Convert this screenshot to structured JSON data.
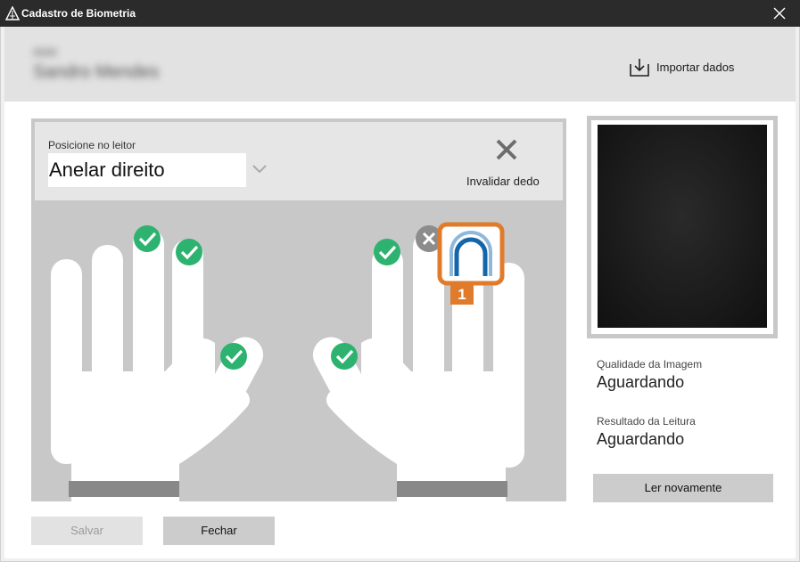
{
  "window": {
    "title": "Cadastro de Biometria",
    "icon": "app-logo-icon",
    "close_icon": "close-icon"
  },
  "header": {
    "person_code": "0000",
    "person_name": "Sandro Mendes",
    "import_label": "Importar dados",
    "import_icon": "import-icon"
  },
  "capture": {
    "caption": "Posicione no leitor",
    "selected_finger": "Anelar direito",
    "dropdown_icon": "chevron-down-icon",
    "invalidate_label": "Invalidar dedo",
    "invalidate_icon": "x-icon",
    "current_step": "1"
  },
  "fingers": {
    "left_hand": {
      "thumb": "captured",
      "index": "captured",
      "middle": "captured",
      "ring": "none",
      "little": "none"
    },
    "right_hand": {
      "thumb": "captured",
      "index": "captured",
      "middle": "invalid",
      "ring": "current",
      "little": "none"
    }
  },
  "status": {
    "quality_label": "Qualidade da Imagem",
    "quality_value": "Aguardando",
    "reading_label": "Resultado da Leitura",
    "reading_value": "Aguardando"
  },
  "buttons": {
    "read_again": "Ler novamente",
    "save": "Salvar",
    "close": "Fechar"
  },
  "colors": {
    "captured": "#2db36f",
    "invalid": "#8c8c8c",
    "current": "#e07b2c",
    "scanner_ring": "#1565a9"
  }
}
